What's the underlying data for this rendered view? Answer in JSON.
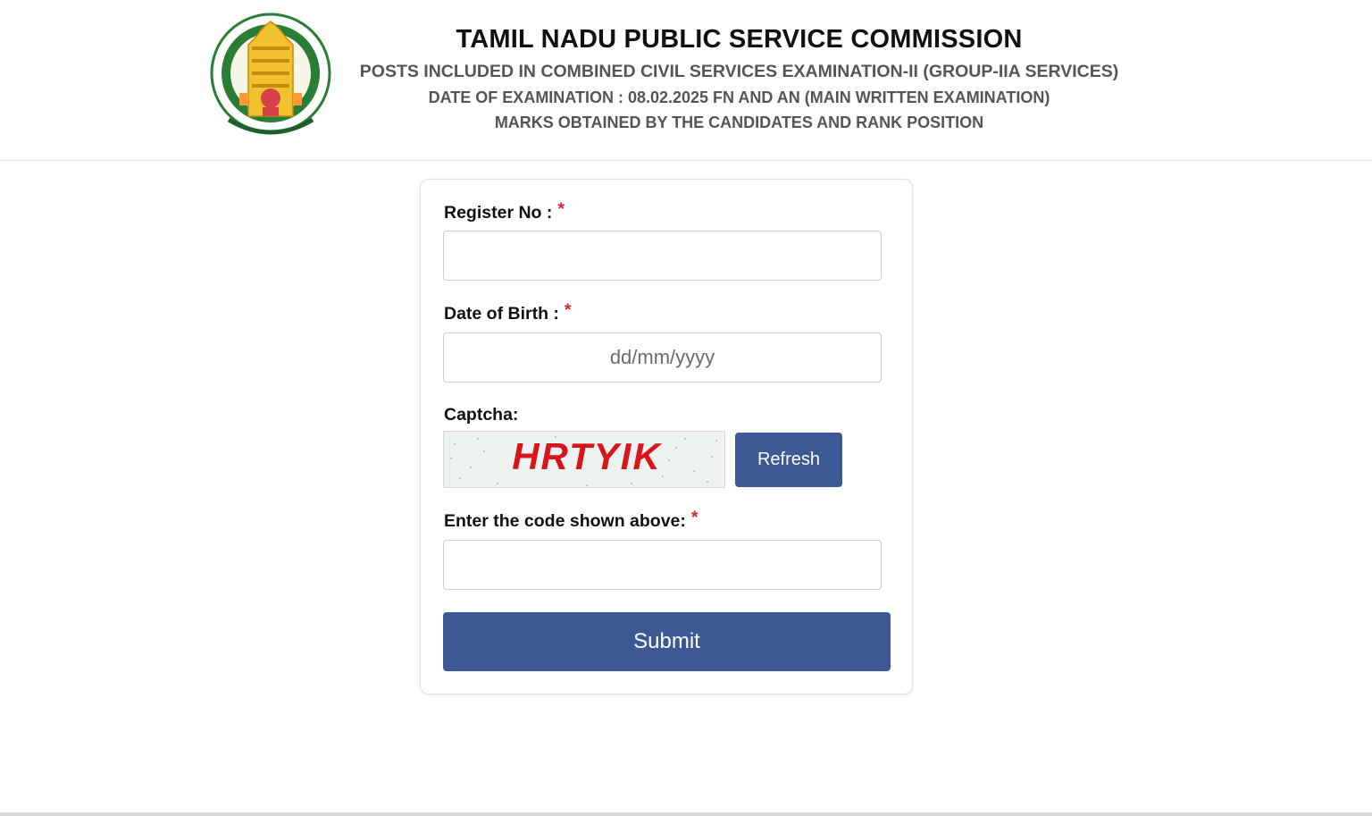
{
  "header": {
    "title": "TAMIL NADU PUBLIC SERVICE COMMISSION",
    "subtitle_1": "POSTS INCLUDED IN COMBINED CIVIL SERVICES EXAMINATION-II (GROUP-IIA SERVICES)",
    "subtitle_2": "DATE OF EXAMINATION : 08.02.2025 FN AND AN (MAIN WRITTEN EXAMINATION)",
    "subtitle_3": "MARKS OBTAINED BY THE CANDIDATES AND RANK POSITION",
    "logo": {
      "icon": "tn-government-emblem-icon",
      "colors": {
        "ring": "#1f7a2e",
        "temple": "#f2c12e",
        "text": "#1f5f2a"
      }
    }
  },
  "form": {
    "register_label": "Register No :",
    "register_value": "",
    "dob_label": "Date of Birth :",
    "dob_placeholder": "dd/mm/yyyy",
    "dob_value": "",
    "captcha_label": "Captcha:",
    "captcha_text": "HRTYIK",
    "refresh_label": "Refresh",
    "code_label": "Enter the code shown above:",
    "code_value": "",
    "submit_label": "Submit",
    "required_marker": "*"
  },
  "colors": {
    "primary_button": "#3c5996",
    "required": "#d9232e",
    "captcha_text": "#d8141d"
  }
}
